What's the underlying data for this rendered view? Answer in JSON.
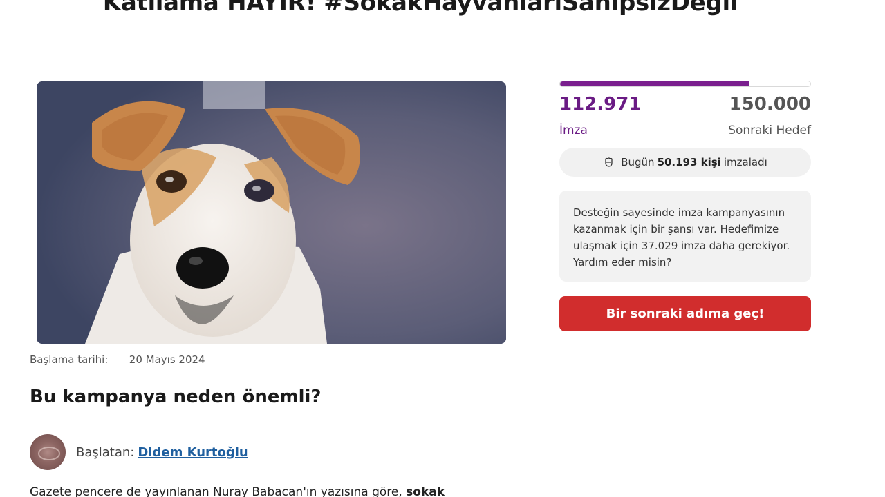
{
  "petition": {
    "title": "Katliama HAYIR! #SokakHayvanlarıSahipsizDeğil"
  },
  "meta": {
    "start_label": "Başlama tarihi:",
    "start_date": "20 Mayıs 2024"
  },
  "section": {
    "heading": "Bu kampanya neden önemli?"
  },
  "starter": {
    "label": "Başlatan:",
    "name": "Didem Kurtoğlu"
  },
  "body": {
    "text_start": "Gazete pencere de yayınlanan Nuray Babacan'ın yazısına göre, ",
    "text_bold": "sokak"
  },
  "progress": {
    "signatures": "112.971",
    "signatures_label": "İmza",
    "goal": "150.000",
    "goal_label": "Sonraki Hedef",
    "fill_fraction": 0.753,
    "fill_color": "#7a1f8e"
  },
  "today": {
    "icon": "raised-fist-icon",
    "prefix": "Bugün",
    "count": "50.193 kişi",
    "suffix": "imzaladı"
  },
  "info": {
    "text": "Desteğin sayesinde imza kampanyasının kazanmak için bir şansı var. Hedefimize ulaşmak için 37.029 imza daha gerekiyor. Yardım eder misin?"
  },
  "cta": {
    "label": "Bir sonraki adıma geç!",
    "color": "#d12d2d"
  }
}
